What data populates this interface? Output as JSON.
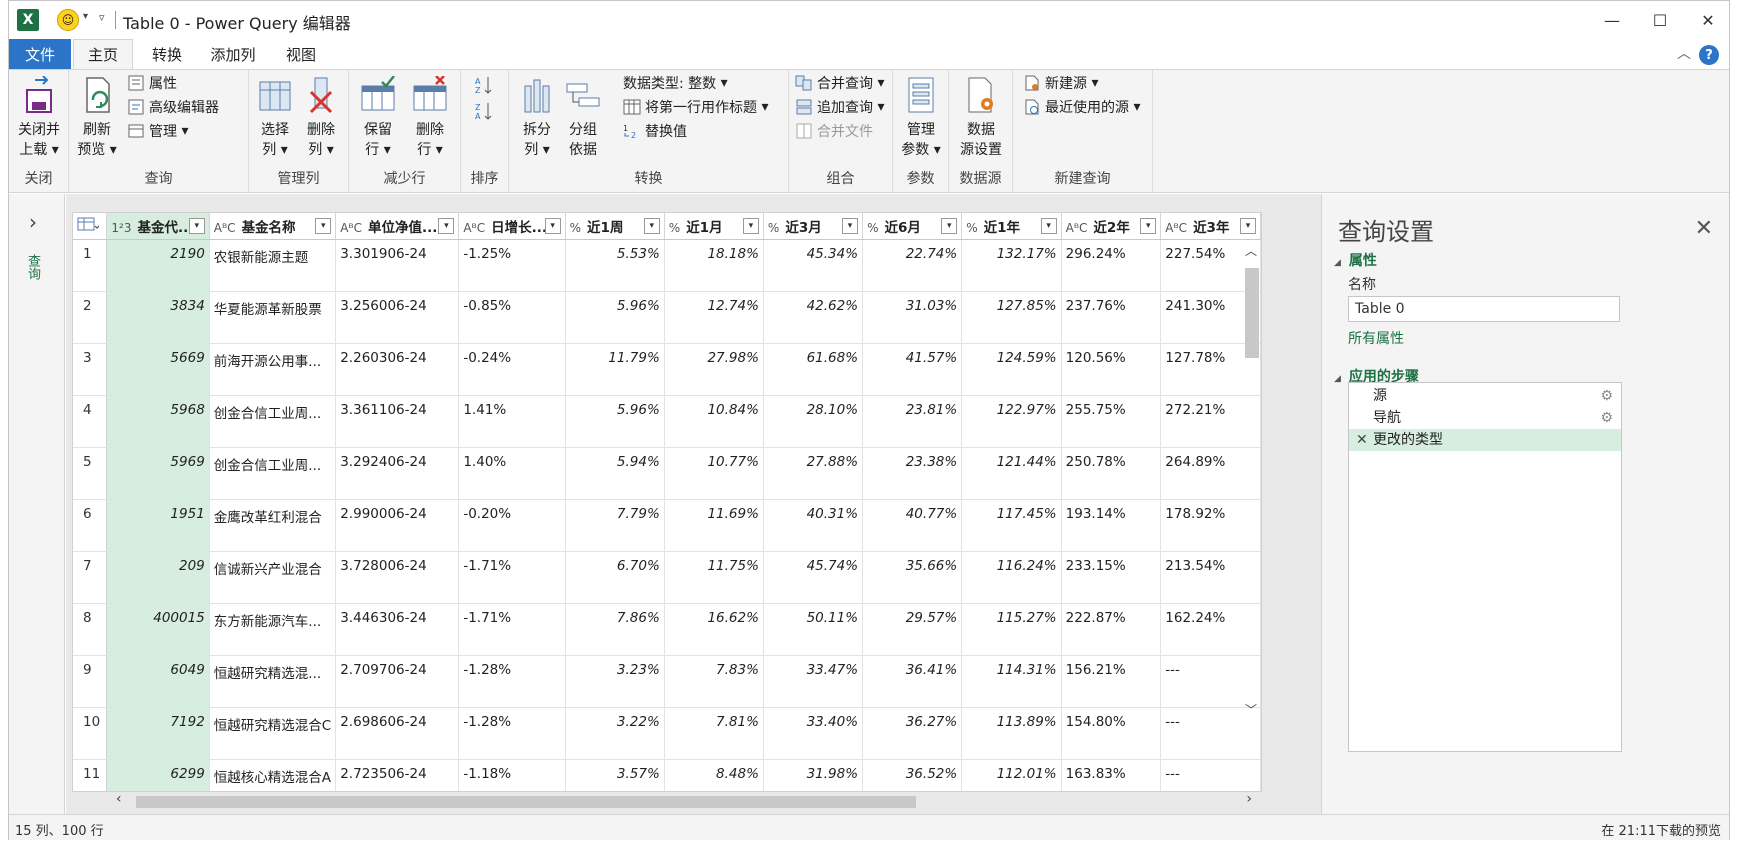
{
  "window": {
    "title": "Table 0 - Power Query 编辑器",
    "app_icon": "X",
    "buttons": [
      "—",
      "☐",
      "✕"
    ]
  },
  "tabs": [
    "文件",
    "主页",
    "转换",
    "添加列",
    "视图"
  ],
  "ribbon": {
    "close": {
      "btn1": "关闭并",
      "btn1b": "上载",
      "label": "关闭"
    },
    "query": {
      "refresh": "刷新",
      "refresh_b": "预览",
      "properties": "属性",
      "advanced": "高级编辑器",
      "manage": "管理",
      "label": "查询"
    },
    "cols": {
      "choose": "选择",
      "choose_b": "列",
      "remove": "删除",
      "remove_b": "列",
      "label": "管理列"
    },
    "rows": {
      "keep": "保留",
      "keep_b": "行",
      "remove": "删除",
      "remove_b": "行",
      "label": "减少行"
    },
    "sort": {
      "label": "排序"
    },
    "transform": {
      "split": "拆分",
      "split_b": "列",
      "group": "分组",
      "group_b": "依据",
      "dtype": "数据类型: 整数",
      "first_row": "将第一行用作标题",
      "replace": "替换值",
      "label": "转换"
    },
    "combine": {
      "merge": "合并查询",
      "append": "追加查询",
      "combine_files": "合并文件",
      "label": "组合"
    },
    "params": {
      "manage": "管理",
      "manage_b": "参数",
      "label": "参数"
    },
    "datasource": {
      "settings": "数据",
      "settings_b": "源设置",
      "label": "数据源"
    },
    "newquery": {
      "new_source": "新建源",
      "recent": "最近使用的源",
      "label": "新建查询"
    }
  },
  "leftnav": {
    "vertical_label": "查询"
  },
  "table": {
    "headers": [
      {
        "type": "1²3",
        "label": "基金代..."
      },
      {
        "type": "AᴮC",
        "label": "基金名称"
      },
      {
        "type": "AᴮC",
        "label": "单位净值..."
      },
      {
        "type": "AᴮC",
        "label": "日增长..."
      },
      {
        "type": "%",
        "label": "近1周"
      },
      {
        "type": "%",
        "label": "近1月"
      },
      {
        "type": "%",
        "label": "近3月"
      },
      {
        "type": "%",
        "label": "近6月"
      },
      {
        "type": "%",
        "label": "近1年"
      },
      {
        "type": "AᴮC",
        "label": "近2年"
      },
      {
        "type": "AᴮC",
        "label": "近3年"
      }
    ],
    "rows": [
      [
        "1",
        "2190",
        "农银新能源主题",
        "3.301906-24",
        "-1.25%",
        "5.53%",
        "18.18%",
        "45.34%",
        "22.74%",
        "132.17%",
        "296.24%",
        "227.54%"
      ],
      [
        "2",
        "3834",
        "华夏能源革新股票",
        "3.256006-24",
        "-0.85%",
        "5.96%",
        "12.74%",
        "42.62%",
        "31.03%",
        "127.85%",
        "237.76%",
        "241.30%"
      ],
      [
        "3",
        "5669",
        "前海开源公用事...",
        "2.260306-24",
        "-0.24%",
        "11.79%",
        "27.98%",
        "61.68%",
        "41.57%",
        "124.59%",
        "120.56%",
        "127.78%"
      ],
      [
        "4",
        "5968",
        "创金合信工业周...",
        "3.361106-24",
        "1.41%",
        "5.96%",
        "10.84%",
        "28.10%",
        "23.81%",
        "122.97%",
        "255.75%",
        "272.21%"
      ],
      [
        "5",
        "5969",
        "创金合信工业周...",
        "3.292406-24",
        "1.40%",
        "5.94%",
        "10.77%",
        "27.88%",
        "23.38%",
        "121.44%",
        "250.78%",
        "264.89%"
      ],
      [
        "6",
        "1951",
        "金鹰改革红利混合",
        "2.990006-24",
        "-0.20%",
        "7.79%",
        "11.69%",
        "40.31%",
        "40.77%",
        "117.45%",
        "193.14%",
        "178.92%"
      ],
      [
        "7",
        "209",
        "信诚新兴产业混合",
        "3.728006-24",
        "-1.71%",
        "6.70%",
        "11.75%",
        "45.74%",
        "35.66%",
        "116.24%",
        "233.15%",
        "213.54%"
      ],
      [
        "8",
        "400015",
        "东方新能源汽车...",
        "3.446306-24",
        "-1.71%",
        "7.86%",
        "16.62%",
        "50.11%",
        "29.57%",
        "115.27%",
        "222.87%",
        "162.24%"
      ],
      [
        "9",
        "6049",
        "恒越研究精选混...",
        "2.709706-24",
        "-1.28%",
        "3.23%",
        "7.83%",
        "33.47%",
        "36.41%",
        "114.31%",
        "156.21%",
        "---"
      ],
      [
        "10",
        "7192",
        "恒越研究精选混合C",
        "2.698606-24",
        "-1.28%",
        "3.22%",
        "7.81%",
        "33.40%",
        "36.27%",
        "113.89%",
        "154.80%",
        "---"
      ],
      [
        "11",
        "6299",
        "恒越核心精选混合A",
        "2.723506-24",
        "-1.18%",
        "3.57%",
        "8.48%",
        "31.98%",
        "36.52%",
        "112.01%",
        "163.83%",
        "---"
      ]
    ]
  },
  "query_settings": {
    "title": "查询设置",
    "properties_header": "属性",
    "name_label": "名称",
    "name_value": "Table 0",
    "all_props": "所有属性",
    "steps_header": "应用的步骤",
    "steps": [
      "源",
      "导航",
      "更改的类型"
    ]
  },
  "status": {
    "left": "15 列、100 行",
    "right": "在 21:11下载的预览"
  }
}
